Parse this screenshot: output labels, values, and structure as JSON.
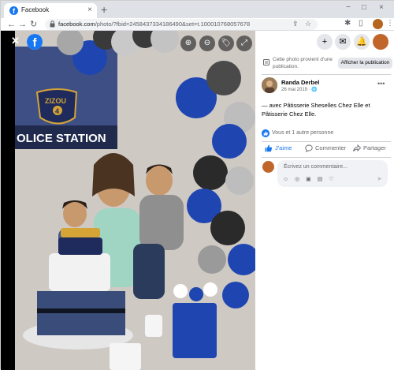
{
  "browser": {
    "tab_title": "Facebook",
    "tab_close": "×",
    "new_tab": "+",
    "window_controls": [
      "−",
      "□",
      "×"
    ],
    "url_host": "facebook.com",
    "url_path": "/photo/?fbid=2458437334186490&set=t.100010768057678"
  },
  "viewer": {
    "close": "✕",
    "logo": "f",
    "zoom_in": "⊕",
    "zoom_out": "⊖",
    "tag": "🏷",
    "fullscreen": "⤢",
    "sign_text": "OLICE STATION",
    "badge_text": "ZIZOU",
    "badge_number": "4"
  },
  "panel": {
    "top_icons": [
      "+",
      "✉",
      "🔔"
    ],
    "notice_text": "Cette photo provient d'une publication.",
    "notice_button": "Afficher la publication",
    "poster_name": "Randa Derbel",
    "poster_date": "26 mai 2019 · 🌐",
    "more": "•••",
    "post_text": "— avec Pâtisserie Sheselles Chez Elle et Pâtisserie Chez Elle.",
    "reactions_text": "Vous et 1 autre personne",
    "actions": {
      "like": "J'aime",
      "comment": "Commenter",
      "share": "Partager"
    },
    "comment_placeholder": "Écrivez un commentaire...",
    "comment_tools": "☺ ◎ ▣ ▤ ♡",
    "send": "➤"
  },
  "colors": {
    "facebook_blue": "#1877f2",
    "text_secondary": "#65676b"
  }
}
